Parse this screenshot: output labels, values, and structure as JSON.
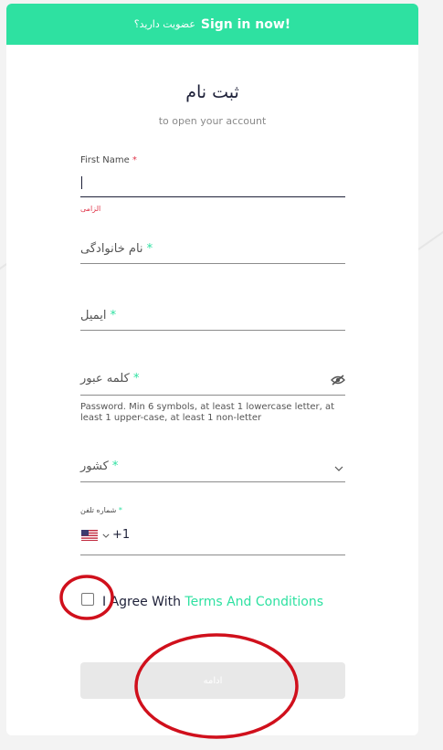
{
  "banner": {
    "question": "عضویت دارید؟",
    "signin_link": "Sign in now!"
  },
  "header": {
    "title": "ثبت نام",
    "subtitle": "to open your account"
  },
  "form": {
    "first_name": {
      "label": "First Name",
      "required_mark": "*",
      "error": "الزامی"
    },
    "last_name": {
      "placeholder": "نام خانوادگی",
      "required_mark": "*"
    },
    "email": {
      "placeholder": "ایمیل",
      "required_mark": "*"
    },
    "password": {
      "placeholder": "کلمه عبور",
      "required_mark": "*",
      "hint": "Password. Min 6 symbols, at least 1 lowercase letter, at least 1 upper-case, at least 1 non-letter",
      "icon": "eye-off-icon"
    },
    "country": {
      "placeholder": "کشور",
      "required_mark": "*",
      "icon": "chevron-down-icon"
    },
    "phone": {
      "label": "شماره تلفن",
      "required_mark": "*",
      "prefix": "+1",
      "flag": "us-flag-icon"
    },
    "agree": {
      "text": "I Agree With",
      "terms_link": "Terms And Conditions"
    },
    "submit_label": "ادامه"
  },
  "colors": {
    "accent": "#2ee1a1",
    "error": "#e0364b",
    "text_dark": "#1e2139",
    "annotation": "#d0101c"
  }
}
